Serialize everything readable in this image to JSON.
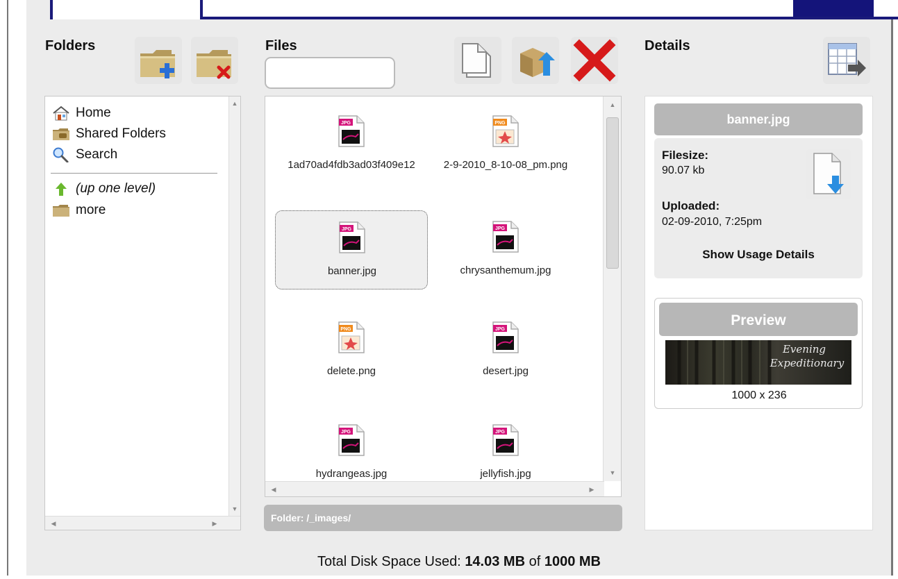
{
  "folders": {
    "title": "Folders",
    "new_folder_icon": "folder-add-icon",
    "delete_folder_icon": "folder-delete-icon",
    "items": [
      {
        "label": "Home",
        "icon": "home-icon"
      },
      {
        "label": "Shared Folders",
        "icon": "shared-folder-icon"
      },
      {
        "label": "Search",
        "icon": "search-icon"
      }
    ],
    "nav": [
      {
        "label": "(up one level)",
        "icon": "up-arrow-icon"
      },
      {
        "label": "more",
        "icon": "folder-icon"
      }
    ]
  },
  "files": {
    "title": "Files",
    "search_value": "",
    "new_file_icon": "new-file-icon",
    "upload_icon": "upload-icon",
    "delete_icon": "delete-icon",
    "items": [
      {
        "name": "1ad70ad4fdb3ad03f409e12",
        "type": "JPG"
      },
      {
        "name": "2-9-2010_8-10-08_pm.png",
        "type": "PNG"
      },
      {
        "name": "banner.jpg",
        "type": "JPG",
        "selected": true
      },
      {
        "name": "chrysanthemum.jpg",
        "type": "JPG"
      },
      {
        "name": "delete.png",
        "type": "PNG"
      },
      {
        "name": "desert.jpg",
        "type": "JPG"
      },
      {
        "name": "hydrangeas.jpg",
        "type": "JPG"
      },
      {
        "name": "jellyfish.jpg",
        "type": "JPG"
      }
    ],
    "folder_path": "Folder: /_images/"
  },
  "details": {
    "title": "Details",
    "export_icon": "export-table-icon",
    "filename": "banner.jpg",
    "filesize_label": "Filesize:",
    "filesize_value": "90.07 kb",
    "uploaded_label": "Uploaded:",
    "uploaded_value": "02-09-2010, 7:25pm",
    "usage_link": "Show Usage Details",
    "download_icon": "download-icon",
    "preview_title": "Preview",
    "preview_text_1": "Evening",
    "preview_text_2": "Expeditionary",
    "dimensions": "1000 x 236"
  },
  "footer": {
    "label": "Total Disk Space Used:",
    "used": "14.03 MB",
    "of": "of",
    "total": "1000 MB"
  },
  "colors": {
    "accent_navy": "#14147a",
    "panel_bg": "#ececec",
    "header_gray": "#b7b7b7",
    "jpg_badge": "#d4147a",
    "png_badge": "#f08a1c",
    "delete_red": "#d61a1a"
  }
}
